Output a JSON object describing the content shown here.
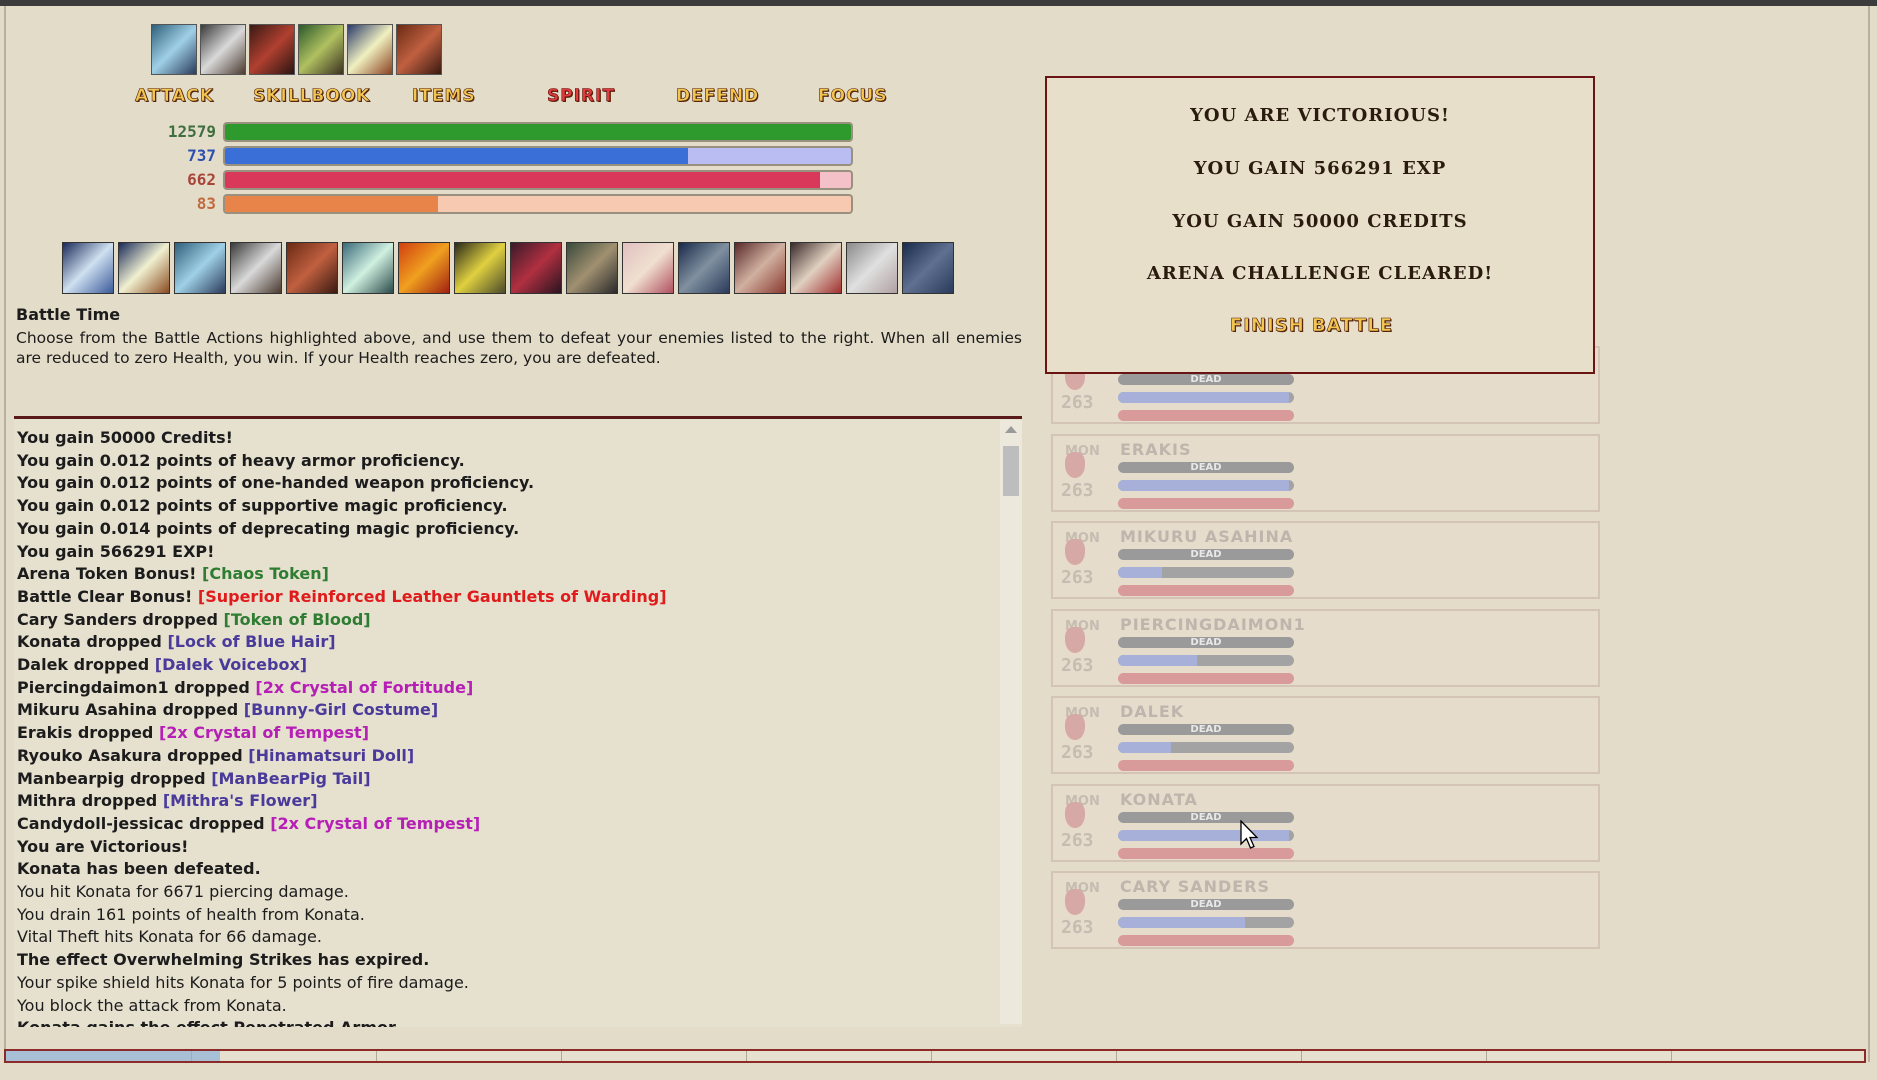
{
  "actions": {
    "attack": "ATTACK",
    "skillbook": "SKILLBOOK",
    "items": "ITEMS",
    "spirit": "SPIRIT",
    "defend": "DEFEND",
    "focus": "FOCUS"
  },
  "vitals": {
    "health": {
      "value": "12579",
      "fill": 1.0
    },
    "magic": {
      "value": "737",
      "fill": 0.74
    },
    "spirit": {
      "value": "662",
      "fill": 0.95
    },
    "overcharge": {
      "value": "83",
      "fill": 0.34
    }
  },
  "colors": {
    "health": "#2e9a2e",
    "magic": "#3a6fd8",
    "magic_bg": "#b9bdf2",
    "spirit": "#d9385a",
    "spirit_bg": "#f3c1c7",
    "overcharge": "#e8844a",
    "overcharge_bg": "#f7c9b0"
  },
  "info": {
    "title": "Battle Time",
    "text": "Choose from the Battle Actions highlighted above, and use them to defeat your enemies listed to the right. When all enemies are reduced to zero Health, you win. If your Health reaches zero, you are defeated."
  },
  "log": [
    {
      "parts": [
        {
          "t": "You gain 50000 Credits!"
        }
      ],
      "bold": true
    },
    {
      "parts": [
        {
          "t": "You gain 0.012 points of heavy armor proficiency."
        }
      ],
      "bold": true
    },
    {
      "parts": [
        {
          "t": "You gain 0.012 points of one-handed weapon proficiency."
        }
      ],
      "bold": true
    },
    {
      "parts": [
        {
          "t": "You gain 0.012 points of supportive magic proficiency."
        }
      ],
      "bold": true
    },
    {
      "parts": [
        {
          "t": "You gain 0.014 points of deprecating magic proficiency."
        }
      ],
      "bold": true
    },
    {
      "parts": [
        {
          "t": "You gain 566291 EXP!"
        }
      ],
      "bold": true
    },
    {
      "parts": [
        {
          "t": "Arena Token Bonus! "
        },
        {
          "t": "[Chaos Token]",
          "c": "#2e7d32"
        }
      ],
      "bold": true
    },
    {
      "parts": [
        {
          "t": "Battle Clear Bonus! "
        },
        {
          "t": "[Superior Reinforced Leather Gauntlets of Warding]",
          "c": "#e01b1b"
        }
      ],
      "bold": true
    },
    {
      "parts": [
        {
          "t": "Cary Sanders dropped "
        },
        {
          "t": "[Token of Blood]",
          "c": "#2e7d32"
        }
      ],
      "bold": true
    },
    {
      "parts": [
        {
          "t": "Konata dropped "
        },
        {
          "t": "[Lock of Blue Hair]",
          "c": "#4a3a9a"
        }
      ],
      "bold": true
    },
    {
      "parts": [
        {
          "t": "Dalek dropped "
        },
        {
          "t": "[Dalek Voicebox]",
          "c": "#4a3a9a"
        }
      ],
      "bold": true
    },
    {
      "parts": [
        {
          "t": "Piercingdaimon1 dropped "
        },
        {
          "t": "[2x Crystal of Fortitude]",
          "c": "#b51fb5"
        }
      ],
      "bold": true
    },
    {
      "parts": [
        {
          "t": "Mikuru Asahina dropped "
        },
        {
          "t": "[Bunny-Girl Costume]",
          "c": "#4a3a9a"
        }
      ],
      "bold": true
    },
    {
      "parts": [
        {
          "t": "Erakis dropped "
        },
        {
          "t": "[2x Crystal of Tempest]",
          "c": "#b51fb5"
        }
      ],
      "bold": true
    },
    {
      "parts": [
        {
          "t": "Ryouko Asakura dropped "
        },
        {
          "t": "[Hinamatsuri Doll]",
          "c": "#4a3a9a"
        }
      ],
      "bold": true
    },
    {
      "parts": [
        {
          "t": "Manbearpig dropped "
        },
        {
          "t": "[ManBearPig Tail]",
          "c": "#4a3a9a"
        }
      ],
      "bold": true
    },
    {
      "parts": [
        {
          "t": "Mithra dropped "
        },
        {
          "t": "[Mithra's Flower]",
          "c": "#4a3a9a"
        }
      ],
      "bold": true
    },
    {
      "parts": [
        {
          "t": "Candydoll-jessicac dropped "
        },
        {
          "t": "[2x Crystal of Tempest]",
          "c": "#b51fb5"
        }
      ],
      "bold": true
    },
    {
      "parts": [
        {
          "t": "You are Victorious!"
        }
      ],
      "bold": true
    },
    {
      "parts": [
        {
          "t": "Konata has been defeated."
        }
      ],
      "bold": true
    },
    {
      "parts": [
        {
          "t": "You hit Konata for 6671 piercing damage."
        }
      ],
      "bold": false
    },
    {
      "parts": [
        {
          "t": "You drain 161 points of health from Konata."
        }
      ],
      "bold": false
    },
    {
      "parts": [
        {
          "t": "Vital Theft hits Konata for 66 damage."
        }
      ],
      "bold": false
    },
    {
      "parts": [
        {
          "t": "The effect Overwhelming Strikes has expired."
        }
      ],
      "bold": true
    },
    {
      "parts": [
        {
          "t": "Your spike shield hits Konata for 5 points of fire damage."
        }
      ],
      "bold": false
    },
    {
      "parts": [
        {
          "t": "You block the attack from Konata."
        }
      ],
      "bold": false
    },
    {
      "parts": [
        {
          "t": "Konata gains the effect Penetrated Armor."
        }
      ],
      "bold": true
    }
  ],
  "monsters": [
    {
      "key": "MON",
      "name": "",
      "level": "263",
      "status": "DEAD",
      "mp": 0.97
    },
    {
      "key": "MON",
      "name": "ERAKIS",
      "level": "263",
      "status": "DEAD",
      "mp": 0.97
    },
    {
      "key": "MON",
      "name": "MIKURU ASAHINA",
      "level": "263",
      "status": "DEAD",
      "mp": 0.25
    },
    {
      "key": "MON",
      "name": "PIERCINGDAIMON1",
      "level": "263",
      "status": "DEAD",
      "mp": 0.45
    },
    {
      "key": "MON",
      "name": "DALEK",
      "level": "263",
      "status": "DEAD",
      "mp": 0.3
    },
    {
      "key": "MON",
      "name": "KONATA",
      "level": "263",
      "status": "DEAD",
      "mp": 0.97
    },
    {
      "key": "MON",
      "name": "CARY SANDERS",
      "level": "263",
      "status": "DEAD",
      "mp": 0.72
    }
  ],
  "dialog": {
    "victorious": "YOU ARE VICTORIOUS!",
    "exp": "YOU GAIN 566291 EXP",
    "credits": "YOU GAIN 50000 CREDITS",
    "arena": "ARENA CHALLENGE CLEARED!",
    "finish": "FINISH BATTLE"
  }
}
